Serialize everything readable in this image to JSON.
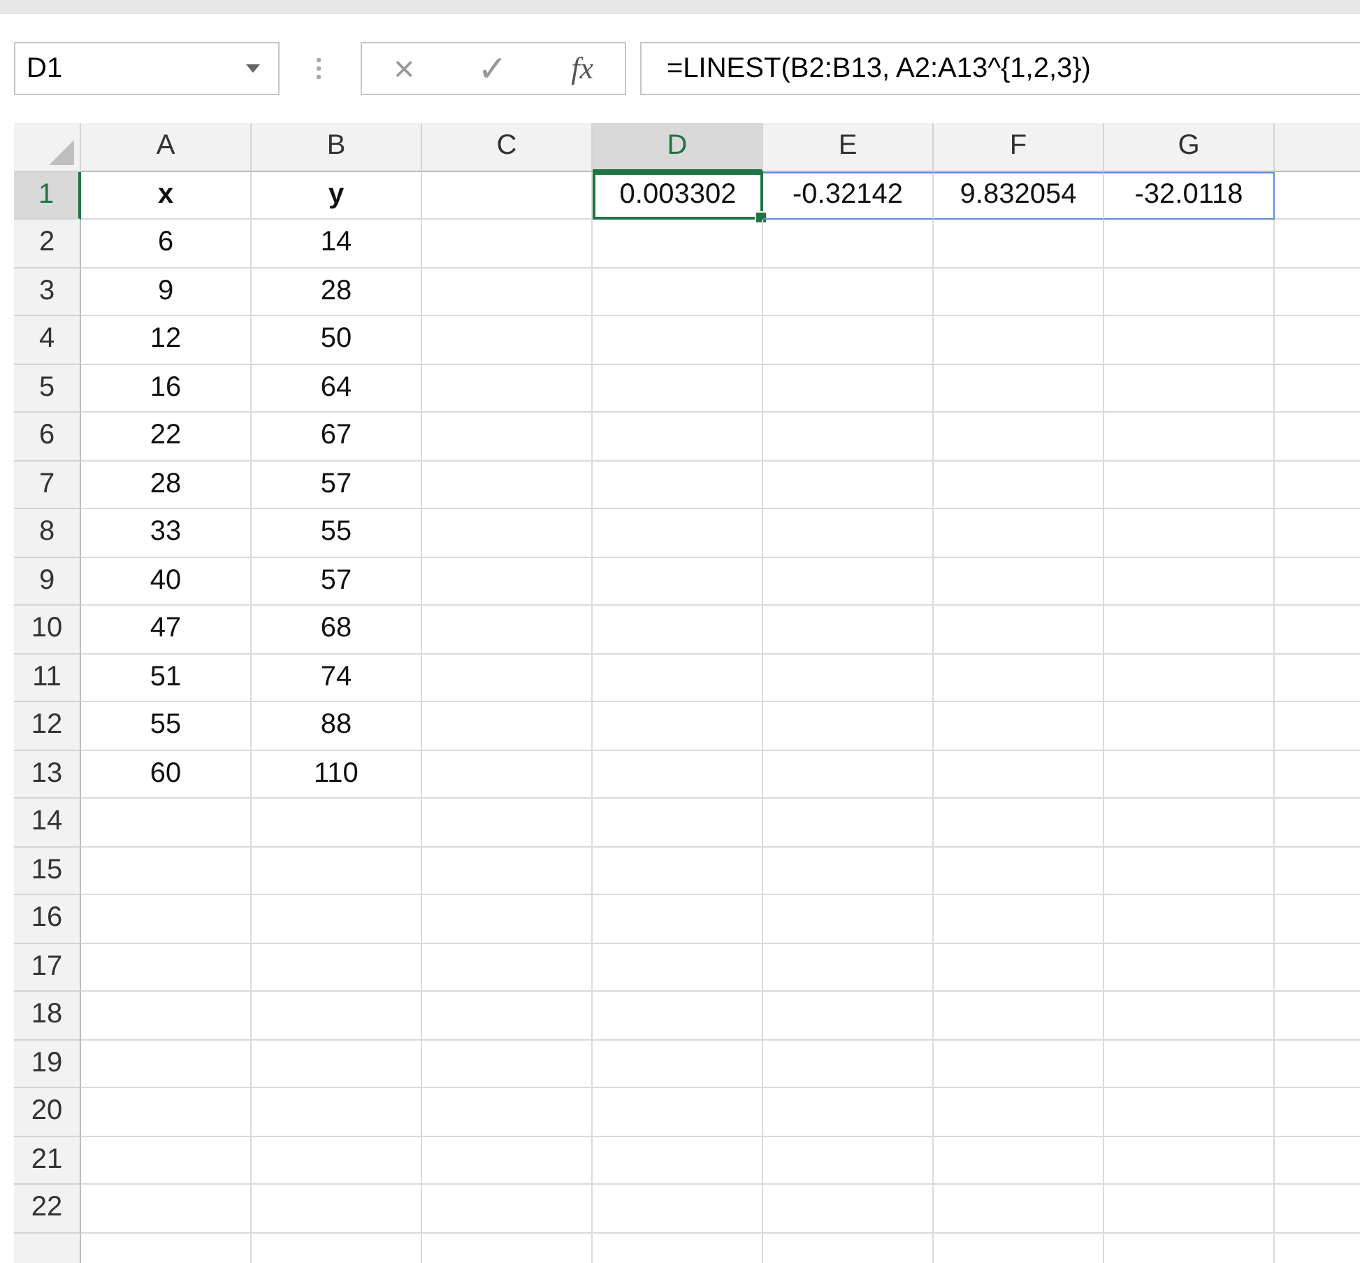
{
  "name_box": {
    "value": "D1"
  },
  "formula_bar": {
    "cancel": "×",
    "enter": "✓",
    "fx": "fx",
    "formula": "=LINEST(B2:B13, A2:A13^{1,2,3})"
  },
  "columns": [
    {
      "label": "A",
      "selected": false
    },
    {
      "label": "B",
      "selected": false
    },
    {
      "label": "C",
      "selected": false
    },
    {
      "label": "D",
      "selected": true
    },
    {
      "label": "E",
      "selected": false
    },
    {
      "label": "F",
      "selected": false
    },
    {
      "label": "G",
      "selected": false
    },
    {
      "selected": false
    }
  ],
  "rows": [
    {
      "label": "1",
      "selected": true,
      "cells": [
        {
          "text": "x",
          "bold": true
        },
        {
          "text": "y",
          "bold": true
        },
        null,
        {
          "text": "0.003302",
          "active": true,
          "spill": true
        },
        {
          "text": "-0.32142",
          "spill": true
        },
        {
          "text": "9.832054",
          "spill": true
        },
        {
          "text": "-32.0118",
          "spill": true
        },
        null
      ]
    },
    {
      "label": "2",
      "selected": false,
      "cells": [
        {
          "text": "6"
        },
        {
          "text": "14"
        }
      ]
    },
    {
      "label": "3",
      "selected": false,
      "cells": [
        {
          "text": "9"
        },
        {
          "text": "28"
        }
      ]
    },
    {
      "label": "4",
      "selected": false,
      "cells": [
        {
          "text": "12"
        },
        {
          "text": "50"
        }
      ]
    },
    {
      "label": "5",
      "selected": false,
      "cells": [
        {
          "text": "16"
        },
        {
          "text": "64"
        }
      ]
    },
    {
      "label": "6",
      "selected": false,
      "cells": [
        {
          "text": "22"
        },
        {
          "text": "67"
        }
      ]
    },
    {
      "label": "7",
      "selected": false,
      "cells": [
        {
          "text": "28"
        },
        {
          "text": "57"
        }
      ]
    },
    {
      "label": "8",
      "selected": false,
      "cells": [
        {
          "text": "33"
        },
        {
          "text": "55"
        }
      ]
    },
    {
      "label": "9",
      "selected": false,
      "cells": [
        {
          "text": "40"
        },
        {
          "text": "57"
        }
      ]
    },
    {
      "label": "10",
      "selected": false,
      "cells": [
        {
          "text": "47"
        },
        {
          "text": "68"
        }
      ]
    },
    {
      "label": "11",
      "selected": false,
      "cells": [
        {
          "text": "51"
        },
        {
          "text": "74"
        }
      ]
    },
    {
      "label": "12",
      "selected": false,
      "cells": [
        {
          "text": "55"
        },
        {
          "text": "88"
        }
      ]
    },
    {
      "label": "13",
      "selected": false,
      "cells": [
        {
          "text": "60"
        },
        {
          "text": "110"
        }
      ]
    },
    {
      "label": "14",
      "selected": false,
      "cells": []
    },
    {
      "label": "15",
      "selected": false,
      "cells": []
    },
    {
      "label": "16",
      "selected": false,
      "cells": []
    },
    {
      "label": "17",
      "selected": false,
      "cells": []
    },
    {
      "label": "18",
      "selected": false,
      "cells": []
    },
    {
      "label": "19",
      "selected": false,
      "cells": []
    },
    {
      "label": "20",
      "selected": false,
      "cells": []
    },
    {
      "label": "21",
      "selected": false,
      "cells": []
    },
    {
      "label": "22",
      "selected": false,
      "cells": []
    },
    {
      "selected": false,
      "cells": []
    }
  ]
}
